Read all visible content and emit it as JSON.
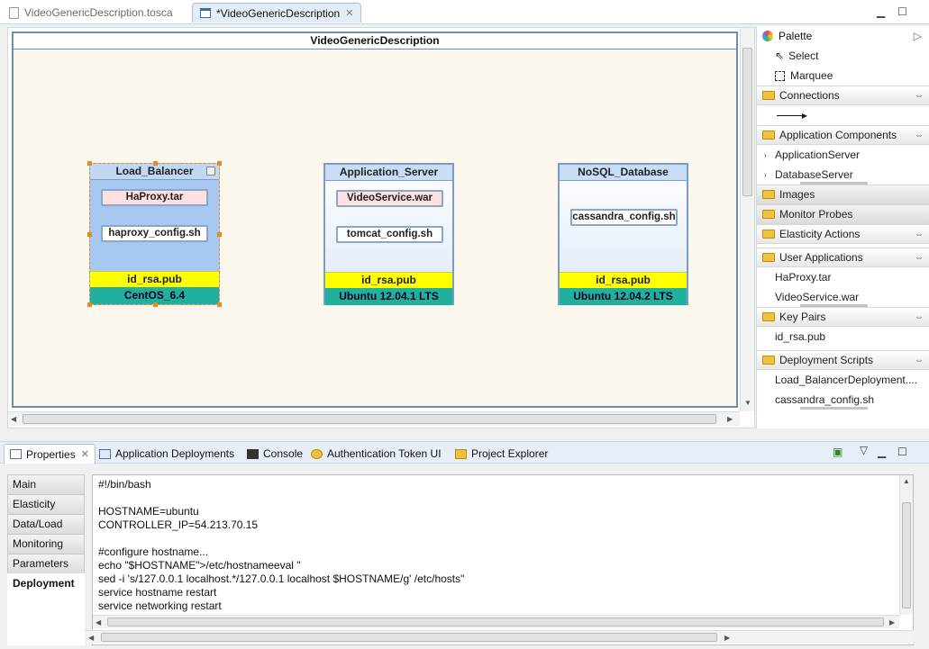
{
  "editor_tabs": [
    {
      "label": "VideoGenericDescription.tosca",
      "active": false
    },
    {
      "label": "*VideoGenericDescription",
      "active": true
    }
  ],
  "diagram": {
    "title": "VideoGenericDescription",
    "nodes": [
      {
        "title": "Load_Balancer",
        "artifacts": [
          "HaProxy.tar",
          "haproxy_config.sh"
        ],
        "key": "id_rsa.pub",
        "os": "CentOS_6.4",
        "selected": true
      },
      {
        "title": "Application_Server",
        "artifacts": [
          "VideoService.war",
          "tomcat_config.sh"
        ],
        "key": "id_rsa.pub",
        "os": "Ubuntu 12.04.1 LTS",
        "selected": false
      },
      {
        "title": "NoSQL_Database",
        "artifacts": [
          "cassandra_config.sh"
        ],
        "key": "id_rsa.pub",
        "os": "Ubuntu 12.04.2 LTS",
        "selected": false
      }
    ]
  },
  "palette": {
    "title": "Palette",
    "tools": [
      "Select",
      "Marquee"
    ],
    "drawers": {
      "connections": "Connections",
      "app_components": "Application Components",
      "app_components_items": [
        "ApplicationServer",
        "DatabaseServer"
      ],
      "images": "Images",
      "monitor_probes": "Monitor Probes",
      "elasticity_actions": "Elasticity Actions",
      "user_applications": "User Applications",
      "user_applications_items": [
        "HaProxy.tar",
        "VideoService.war"
      ],
      "key_pairs": "Key Pairs",
      "key_pairs_items": [
        "id_rsa.pub"
      ],
      "deployment_scripts": "Deployment Scripts",
      "deployment_scripts_items": [
        "Load_BalancerDeployment....",
        "cassandra_config.sh"
      ]
    }
  },
  "views": {
    "tabs": [
      "Properties",
      "Application Deployments",
      "Console",
      "Authentication Token UI",
      "Project Explorer"
    ]
  },
  "properties": {
    "sections": [
      "Main",
      "Elasticity",
      "Data/Load",
      "Monitoring",
      "Parameters",
      "Deployment"
    ],
    "active_section": "Deployment",
    "script_lines": [
      "#!/bin/bash",
      "",
      "HOSTNAME=ubuntu",
      "CONTROLLER_IP=54.213.70.15",
      "",
      "#configure hostname...",
      "echo \"$HOSTNAME\">/etc/hostnameeval \"",
      "sed -i 's/127.0.0.1 localhost.*/127.0.0.1 localhost $HOSTNAME/g' /etc/hosts\"",
      "service hostname restart",
      "service networking restart"
    ]
  },
  "colors": {
    "key_bar": "#ffff00",
    "os_bar": "#1fb0a0",
    "selection": "#e38b24"
  }
}
